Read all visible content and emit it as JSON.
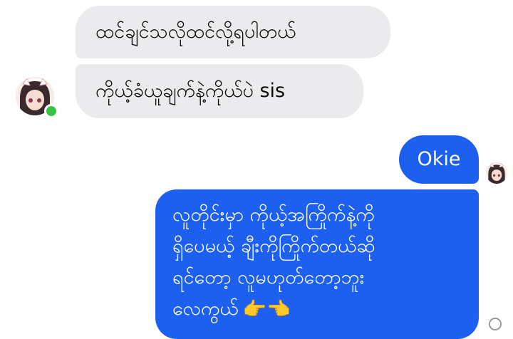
{
  "messages": [
    {
      "direction": "incoming",
      "text": "ထင်ချင်သလိုထင်လို့ရပါတယ်"
    },
    {
      "direction": "incoming",
      "text": "ကိုယ့်ခံယူချက်နဲ့ကိုယ်ပဲ sis"
    },
    {
      "direction": "outgoing",
      "text": "Okie"
    },
    {
      "direction": "outgoing",
      "lines": [
        "လူတိုင်းမှာ ကိုယ့်အကြိုက်နဲ့ကို",
        "ရှိပေမယ့် ချီးကိုကြိုက်တယ်ဆို",
        "ရင်တော့ လူမဟုတ်တော့ဘူး",
        "လေကွယ်"
      ],
      "emoji": "👉👈"
    }
  ],
  "contact": {
    "online": true
  },
  "colors": {
    "incoming_bubble": "#ebebee",
    "outgoing_bubble": "#1d60ef",
    "online": "#38c441"
  },
  "icons": {
    "avatar": "anime-girl-avatar",
    "status": "online-dot-icon",
    "read_receipt": "seen-indicator-icon"
  }
}
